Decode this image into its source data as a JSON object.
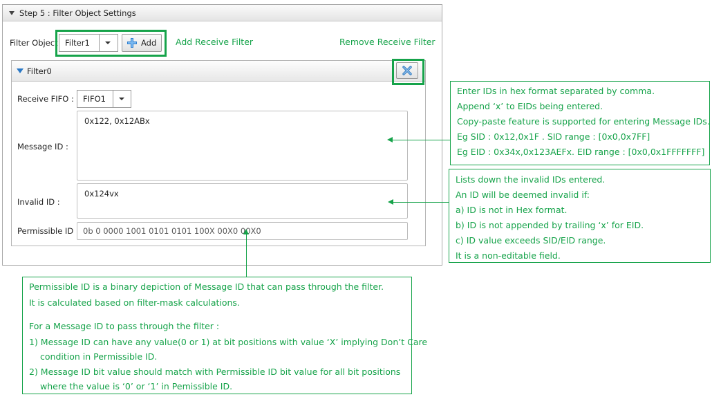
{
  "step_panel": {
    "title": "Step 5 : Filter Object Settings"
  },
  "filter_object": {
    "label": "Filter Object",
    "selected": "Filter1",
    "add_label": "Add"
  },
  "links": {
    "add_receive_filter": "Add Receive Filter",
    "remove_receive_filter": "Remove Receive Filter"
  },
  "filter": {
    "title": "Filter0",
    "receive_fifo": {
      "label": "Receive FIFO :",
      "value": "FIFO1"
    },
    "message_id": {
      "label": "Message ID :",
      "value": "0x122, 0x12ABx"
    },
    "invalid_id": {
      "label": "Invalid ID :",
      "value": "0x124vx"
    },
    "permissible_id": {
      "label": "Permissible ID :",
      "value": "0b 0 0000 1001 0101 0101 100X 00X0 00X0"
    }
  },
  "notes": {
    "message_id_note": [
      "Enter IDs in hex format separated by comma.",
      "Append ‘x’ to EIDs being entered.",
      "Copy-paste feature is supported for entering Message IDs.",
      "Eg SID : 0x12,0x1F . SID range : [0x0,0x7FF]",
      "Eg EID : 0x34x,0x123AEFx. EID range : [0x0,0x1FFFFFFF]"
    ],
    "invalid_id_note": [
      "Lists down the invalid IDs entered.",
      "An ID will be deemed invalid if:",
      "a) ID is not in Hex format.",
      "b) ID is not appended by trailing ‘x’ for EID.",
      "c) ID value exceeds SID/EID range.",
      "It is a non-editable field."
    ],
    "permissible_note": [
      "Permissible ID is a binary depiction of Message ID that can pass through the filter.",
      "It is calculated based on filter-mask calculations.",
      "For a Message ID to pass through the filter :",
      "1) Message ID can have any value(0 or 1) at bit positions with value ‘X’ implying Don’t Care",
      "condition in Permissible ID.",
      "2) Message ID bit value should match with Permissible ID bit value for all bit positions",
      "where the value is ‘0’ or ‘1’ in Pemissible ID."
    ]
  },
  "colors": {
    "accent_green": "#16a34a",
    "close_blue": "#3b82c4"
  },
  "icons": {
    "collapse": "triangle-down-icon",
    "add": "plus-icon",
    "close": "close-x-icon",
    "dropdown": "chevron-down-icon"
  }
}
